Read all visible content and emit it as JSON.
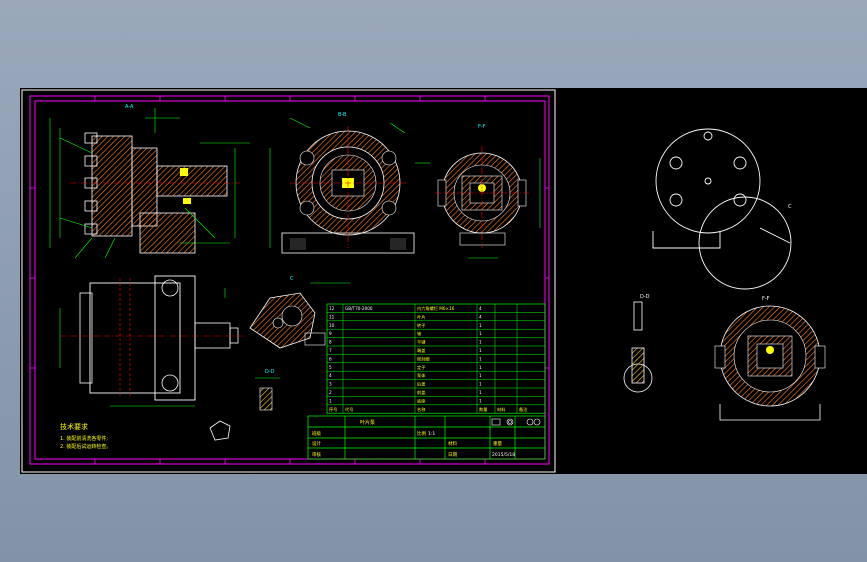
{
  "views": {
    "section_aa": "A-A",
    "section_bb": "B-B",
    "section_ff": "F-F",
    "section_c": "C",
    "section_dd": "D-D"
  },
  "tech_req": {
    "title": "技术要求",
    "lines": [
      "1. 装配前清洗各零件;",
      "2. 装配后试运转检查。"
    ]
  },
  "bom": {
    "header": [
      "序号",
      "代号",
      "名称",
      "数量",
      "材料",
      "备注"
    ],
    "rows": [
      {
        "no": "12",
        "code": "GB/T70-2000",
        "name": "内六角螺钉 M6×16",
        "qty": "4",
        "mat": "",
        "note": ""
      },
      {
        "no": "11",
        "code": "",
        "name": "叶片",
        "qty": "4",
        "mat": "",
        "note": ""
      },
      {
        "no": "10",
        "code": "",
        "name": "转子",
        "qty": "1",
        "mat": "",
        "note": ""
      },
      {
        "no": "9",
        "code": "",
        "name": "轴",
        "qty": "1",
        "mat": "",
        "note": ""
      },
      {
        "no": "8",
        "code": "",
        "name": "平键",
        "qty": "1",
        "mat": "",
        "note": ""
      },
      {
        "no": "7",
        "code": "",
        "name": "端盖",
        "qty": "1",
        "mat": "",
        "note": ""
      },
      {
        "no": "6",
        "code": "",
        "name": "密封圈",
        "qty": "1",
        "mat": "",
        "note": ""
      },
      {
        "no": "5",
        "code": "",
        "name": "定子",
        "qty": "1",
        "mat": "",
        "note": ""
      },
      {
        "no": "4",
        "code": "",
        "name": "泵体",
        "qty": "1",
        "mat": "",
        "note": ""
      },
      {
        "no": "3",
        "code": "",
        "name": "后盖",
        "qty": "1",
        "mat": "",
        "note": ""
      },
      {
        "no": "2",
        "code": "",
        "name": "前盖",
        "qty": "1",
        "mat": "",
        "note": ""
      },
      {
        "no": "1",
        "code": "",
        "name": "底座",
        "qty": "1",
        "mat": "",
        "note": ""
      }
    ]
  },
  "title_block": {
    "drawing_title": "叶片泵",
    "school": "班级",
    "scale_label": "比例",
    "scale_value": "1:1",
    "designer_label": "设计",
    "checker_label": "审核",
    "materials_label": "材料",
    "weight_label": "重量",
    "date_label": "日期",
    "date_value": "2015/5/18"
  },
  "colors": {
    "border": "#ff00ff",
    "line": "#ffffff",
    "green": "#00ff00",
    "yellow": "#ffff00",
    "cyan": "#00ffff",
    "red": "#ff0000",
    "hatch": "#ff7f2a"
  }
}
